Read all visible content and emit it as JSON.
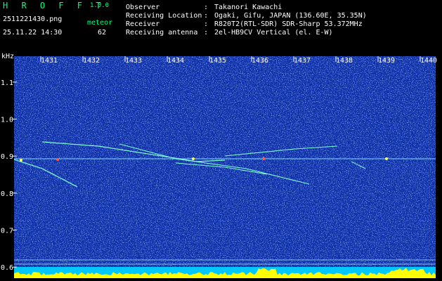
{
  "app": {
    "name": "H R O F F T",
    "version": "1.0.0"
  },
  "file": {
    "name": "2511221430.png",
    "datetime": "25.11.22 14:30"
  },
  "counter": {
    "label": "meteor",
    "value": "62"
  },
  "info": [
    {
      "key": "Observer",
      "value": "Takanori Kawachi"
    },
    {
      "key": "Receiving Location",
      "value": "Ogaki, Gifu, JAPAN (136.60E, 35.35N)"
    },
    {
      "key": "Receiver",
      "value": "R820T2(RTL-SDR) SDR-Sharp 53.372MHz"
    },
    {
      "key": "Receiving antenna",
      "value": "2el-HB9CV Vertical (el. E-W)"
    }
  ],
  "colors": {
    "accent": "#00ff80",
    "background": "#0c2ea8",
    "echo": "#00ffff",
    "signal": "#ffff00"
  },
  "chart_data": {
    "type": "heatmap",
    "y_unit": "kHz",
    "x_ticks": [
      "1431",
      "1432",
      "1433",
      "1434",
      "1435",
      "1436",
      "1437",
      "1438",
      "1439",
      "1440"
    ],
    "y_ticks": [
      "1.1",
      "1.0",
      "0.9",
      "0.8",
      "0.7",
      "0.6"
    ],
    "ylim": [
      0.57,
      1.17
    ]
  }
}
